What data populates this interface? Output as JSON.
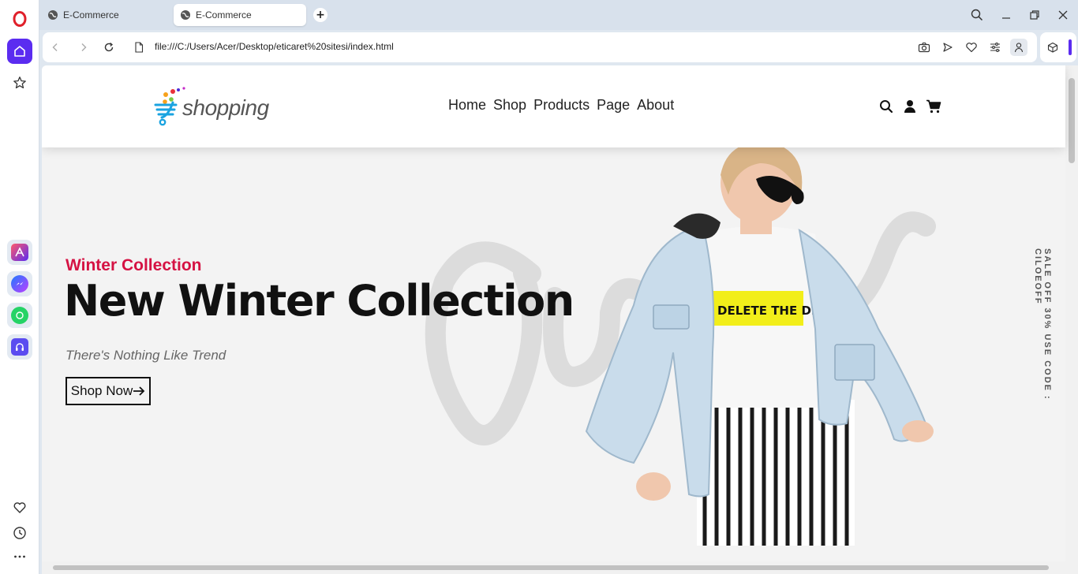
{
  "browser": {
    "tabs": [
      {
        "title": "E-Commerce"
      },
      {
        "title": "E-Commerce"
      }
    ],
    "url": "file:///C:/Users/Acer/Desktop/eticaret%20sitesi/index.html",
    "accent_color": "#5b2cf0"
  },
  "site": {
    "logo_text": "shopping",
    "nav": [
      "Home",
      "Shop",
      "Products",
      "Page",
      "About"
    ],
    "hero": {
      "kicker": "Winter Collection",
      "title": "New Winter Collection",
      "tagline": "There's Nothing Like Trend",
      "button_label": "Shop Now",
      "vertical_promo": "SALE OFF 30% USE CODE : CILOEOFF",
      "kicker_color": "#d51243",
      "tshirt_text": "DELETE THE DRAMA"
    }
  }
}
